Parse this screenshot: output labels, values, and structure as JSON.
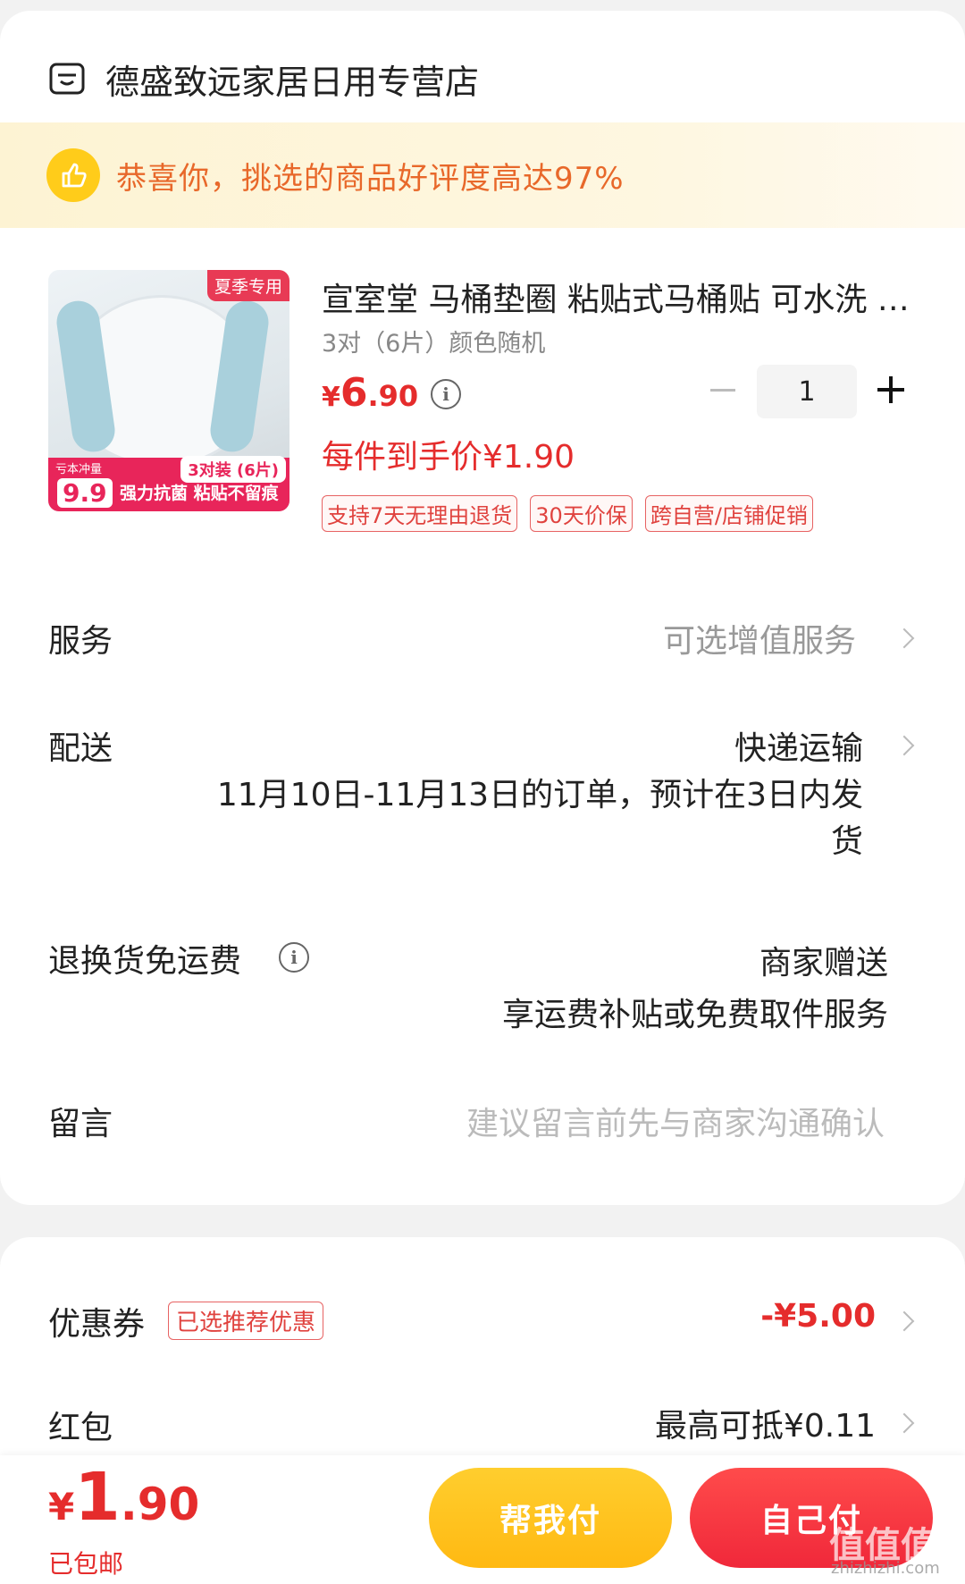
{
  "store": {
    "name": "德盛致远家居日用专营店"
  },
  "banner": {
    "text": "恭喜你，挑选的商品好评度高达97%"
  },
  "product": {
    "image": {
      "tag_summer": "夏季专用",
      "pack": "3对装 (6片)",
      "price": "9.9",
      "slogan": "强力抗菌 粘贴不留痕",
      "small": "亏本冲量"
    },
    "title": "宣室堂 马桶垫圈 粘贴式马桶贴 可水洗 加厚",
    "spec": "3对（6片）颜色随机",
    "price_currency": "¥",
    "price_int": "6",
    "price_dec": ".90",
    "quantity": "1",
    "final_price": "每件到手价¥1.90",
    "tags": [
      "支持7天无理由退货",
      "30天价保",
      "跨自营/店铺促销"
    ]
  },
  "rows": {
    "service": {
      "label": "服务",
      "value": "可选增值服务"
    },
    "delivery": {
      "label": "配送",
      "value": "快递运输",
      "note": "11月10日-11月13日的订单，预计在3日内发货"
    },
    "return": {
      "label": "退换货免运费",
      "value": "商家赠送",
      "note": "享运费补贴或免费取件服务"
    },
    "message": {
      "label": "留言",
      "placeholder": "建议留言前先与商家沟通确认"
    }
  },
  "discounts": {
    "coupon": {
      "label": "优惠券",
      "chip": "已选推荐优惠",
      "value": "-¥5.00"
    },
    "redpacket": {
      "label": "红包",
      "value": "最高可抵¥0.11"
    }
  },
  "bottom": {
    "currency": "¥",
    "total_int": "1",
    "total_dec": ".90",
    "shipping": "已包邮",
    "help_pay": "帮我付",
    "self_pay": "自己付"
  },
  "watermark": {
    "logo": "值值值",
    "url": "zhizhizhi.com"
  },
  "colors": {
    "accent_red": "#e52c2c",
    "banner_orange": "#e8682a",
    "help_yellow": "#ffb912",
    "self_red": "#f0283a"
  }
}
